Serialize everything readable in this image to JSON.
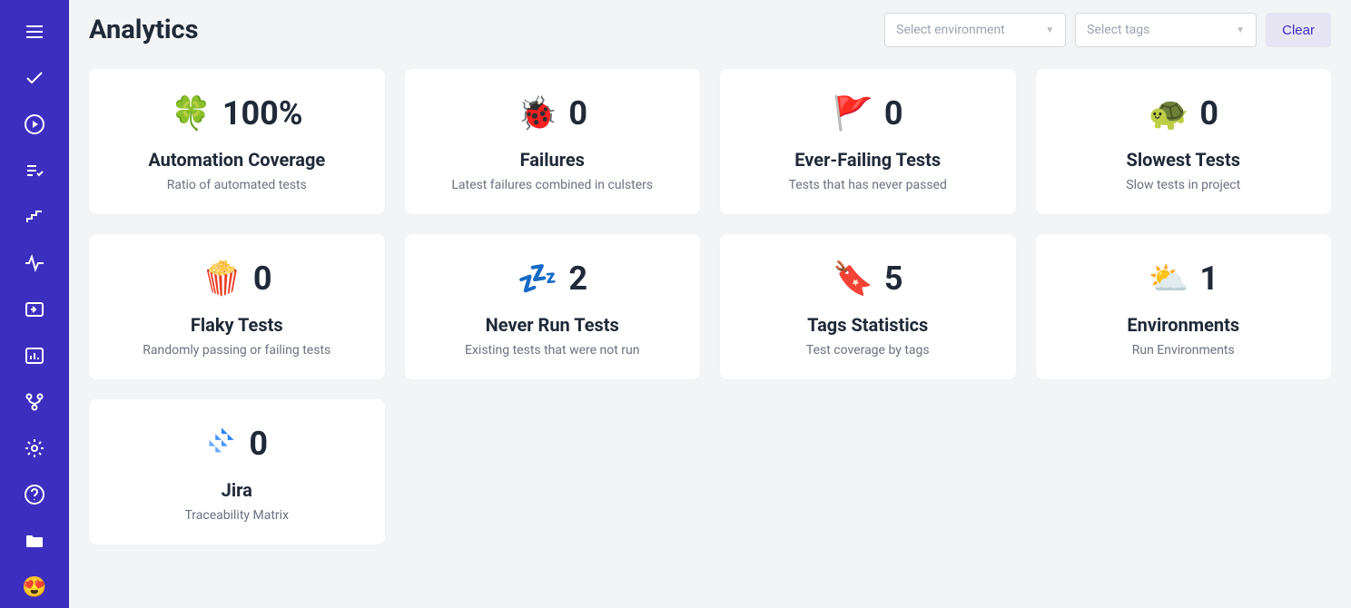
{
  "header": {
    "title": "Analytics",
    "select_env_placeholder": "Select environment",
    "select_tags_placeholder": "Select tags",
    "clear_label": "Clear"
  },
  "sidebar": {
    "items": [
      {
        "name": "hamburger-icon"
      },
      {
        "name": "check-icon"
      },
      {
        "name": "play-icon"
      },
      {
        "name": "list-check-icon"
      },
      {
        "name": "steps-icon"
      },
      {
        "name": "pulse-icon"
      },
      {
        "name": "import-icon"
      },
      {
        "name": "analytics-icon"
      },
      {
        "name": "branch-icon"
      },
      {
        "name": "gear-icon"
      },
      {
        "name": "help-icon"
      },
      {
        "name": "folder-icon"
      },
      {
        "name": "heart-eyes-emoji"
      }
    ]
  },
  "cards": [
    {
      "icon": "🍀",
      "value": "100%",
      "title": "Automation Coverage",
      "subtitle": "Ratio of automated tests"
    },
    {
      "icon": "🐞",
      "value": "0",
      "title": "Failures",
      "subtitle": "Latest failures combined in culsters"
    },
    {
      "icon": "🚩",
      "value": "0",
      "title": "Ever-Failing Tests",
      "subtitle": "Tests that has never passed"
    },
    {
      "icon": "🐢",
      "value": "0",
      "title": "Slowest Tests",
      "subtitle": "Slow tests in project"
    },
    {
      "icon": "🍿",
      "value": "0",
      "title": "Flaky Tests",
      "subtitle": "Randomly passing or failing tests"
    },
    {
      "icon": "💤",
      "value": "2",
      "title": "Never Run Tests",
      "subtitle": "Existing tests that were not run"
    },
    {
      "icon": "🔖",
      "value": "5",
      "title": "Tags Statistics",
      "subtitle": "Test coverage by tags"
    },
    {
      "icon": "⛅",
      "value": "1",
      "title": "Environments",
      "subtitle": "Run Environments"
    },
    {
      "icon": "jira",
      "value": "0",
      "title": "Jira",
      "subtitle": "Traceability Matrix"
    }
  ]
}
